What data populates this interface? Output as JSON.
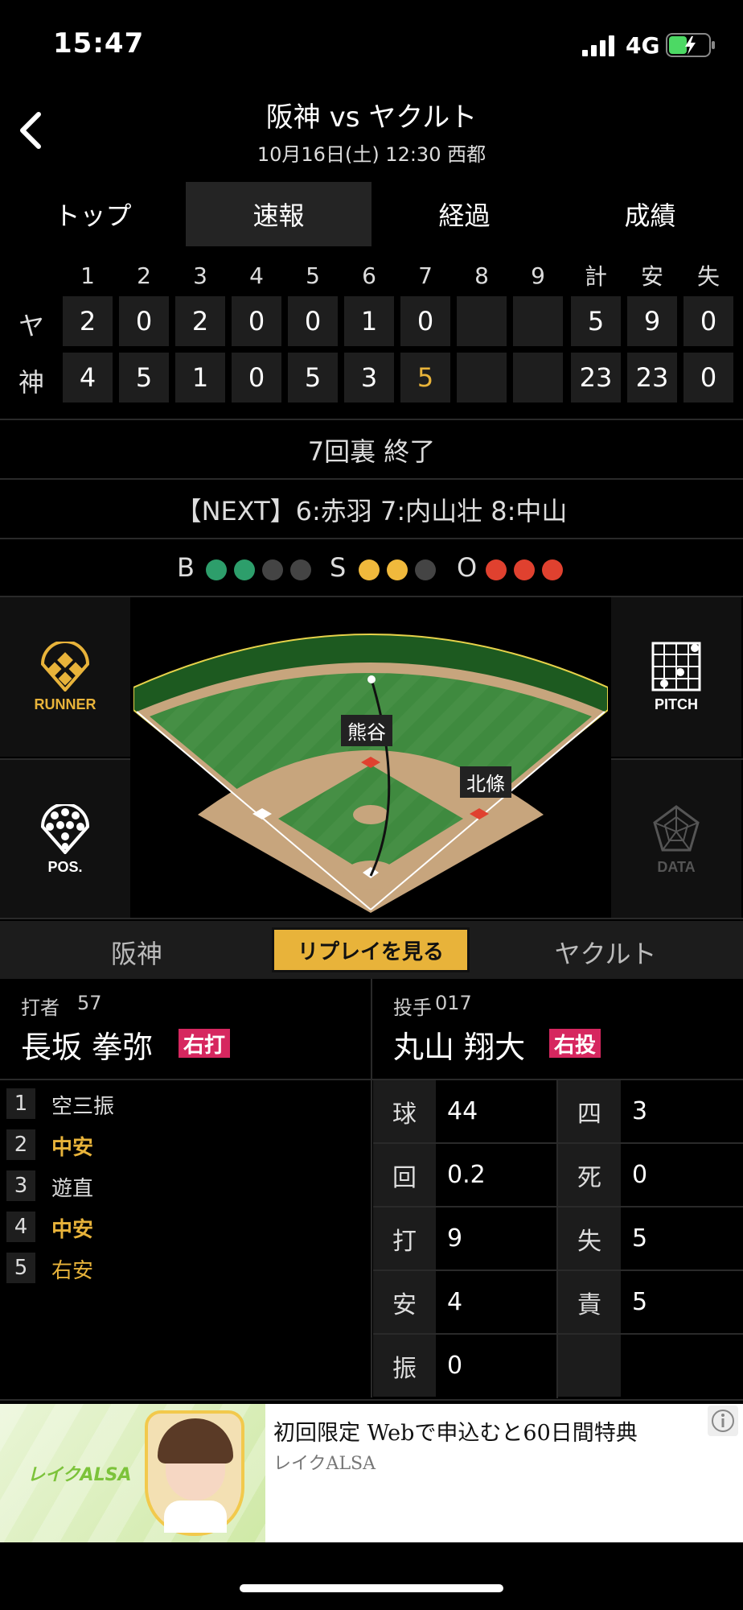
{
  "status_bar": {
    "time": "15:47",
    "network": "4G"
  },
  "header": {
    "title": "阪神 vs ヤクルト",
    "subtitle": "10月16日(土) 12:30 西都"
  },
  "tabs": [
    {
      "label": "トップ",
      "active": false
    },
    {
      "label": "速報",
      "active": true
    },
    {
      "label": "経過",
      "active": false
    },
    {
      "label": "成績",
      "active": false
    }
  ],
  "scoreboard": {
    "columns": [
      "1",
      "2",
      "3",
      "4",
      "5",
      "6",
      "7",
      "8",
      "9",
      "計",
      "安",
      "失"
    ],
    "rows": [
      {
        "team": "ヤ",
        "cells": [
          "2",
          "0",
          "2",
          "0",
          "0",
          "1",
          "0",
          "",
          "",
          "5",
          "9",
          "0"
        ]
      },
      {
        "team": "神",
        "cells": [
          "4",
          "5",
          "1",
          "0",
          "5",
          "3",
          "5",
          "",
          "",
          "23",
          "23",
          "0"
        ]
      }
    ],
    "highlight_color": "#e8b33a"
  },
  "inning_status": "7回裏 終了",
  "next_batters": "【NEXT】6:赤羽 7:内山壮 8:中山",
  "count": {
    "b_label": "B",
    "s_label": "S",
    "o_label": "O",
    "balls": 2,
    "balls_max": 4,
    "strikes": 2,
    "strikes_max": 3,
    "outs": 3,
    "outs_max": 3,
    "colors": {
      "ball": "#2d9e6b",
      "strike": "#f0b93c",
      "out": "#e0412f",
      "off": "#444444"
    }
  },
  "side_buttons": {
    "runner": "RUNNER",
    "pos": "POS.",
    "pitch": "PITCH",
    "data": "DATA"
  },
  "field": {
    "fielder_center": "熊谷",
    "fielder_right": "北條"
  },
  "team_bar": {
    "home": "阪神",
    "replay": "リプレイを見る",
    "away": "ヤクルト"
  },
  "batter": {
    "role": "打者",
    "number": "57",
    "name": "長坂 拳弥",
    "badge": "右打",
    "at_bats": [
      {
        "no": "1",
        "result": "空三振",
        "type": "out"
      },
      {
        "no": "2",
        "result": "中安",
        "type": "hit"
      },
      {
        "no": "3",
        "result": "遊直",
        "type": "out"
      },
      {
        "no": "4",
        "result": "中安",
        "type": "hit"
      },
      {
        "no": "5",
        "result": "右安",
        "type": "hit-latest"
      }
    ]
  },
  "pitcher": {
    "role": "投手",
    "number": "017",
    "name": "丸山 翔大",
    "badge": "右投",
    "stats": [
      {
        "key": "球",
        "value": "44"
      },
      {
        "key": "四",
        "value": "3"
      },
      {
        "key": "回",
        "value": "0.2"
      },
      {
        "key": "死",
        "value": "0"
      },
      {
        "key": "打",
        "value": "9"
      },
      {
        "key": "失",
        "value": "5"
      },
      {
        "key": "安",
        "value": "4"
      },
      {
        "key": "責",
        "value": "5"
      },
      {
        "key": "振",
        "value": "0"
      }
    ]
  },
  "ad": {
    "title": "初回限定 Webで申込むと60日間特典",
    "sponsor": "レイクALSA",
    "logo_text": "レイクALSA"
  }
}
